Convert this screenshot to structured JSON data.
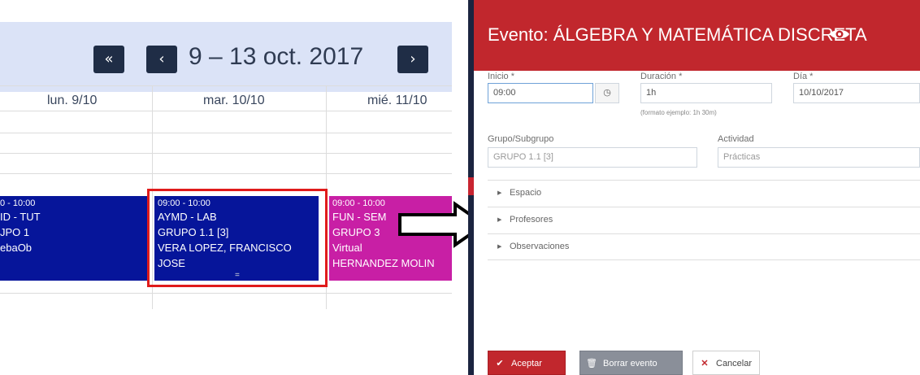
{
  "calendar": {
    "nav_first": "«",
    "nav_prev": "‹",
    "nav_next": "›",
    "title": "9 – 13 oct. 2017",
    "days": [
      "lun. 9/10",
      "mar. 10/10",
      "mié. 11/10"
    ],
    "events": [
      {
        "time": "0 - 10:00",
        "lines": [
          "ID - TUT",
          "JPO 1",
          "ebaOb"
        ],
        "color": "#06159a"
      },
      {
        "time": "09:00 - 10:00",
        "lines": [
          "AYMD - LAB",
          "GRUPO 1.1 [3]",
          "VERA LOPEZ, FRANCISCO",
          "JOSE"
        ],
        "handle": "=",
        "color": "#06159a"
      },
      {
        "time": "09:00 - 10:00",
        "lines": [
          "FUN - SEM",
          "GRUPO 3",
          "Virtual",
          "HERNANDEZ MOLIN"
        ],
        "color": "#c81fa5"
      }
    ],
    "highlight_color": "#e01b1b"
  },
  "modal": {
    "title": "Evento: ÁLGEBRA Y MATEMÁTICA DISCRETA",
    "header_color": "#c1272d",
    "eye_icon": "eye-icon",
    "inicio": {
      "label": "Inicio *",
      "value": "09:00",
      "clock_icon": "clock-icon",
      "clock_glyph": "◷"
    },
    "duracion": {
      "label": "Duración *",
      "value": "1h",
      "help": "(formato ejemplo: 1h 30m)"
    },
    "dia": {
      "label": "Día *",
      "value": "10/10/2017"
    },
    "grupo": {
      "label": "Grupo/Subgrupo",
      "value": "GRUPO 1.1 [3]"
    },
    "actividad": {
      "label": "Actividad",
      "value": "Prácticas"
    },
    "sections": [
      {
        "label": "Espacio"
      },
      {
        "label": "Profesores"
      },
      {
        "label": "Observaciones"
      }
    ],
    "buttons": {
      "accept": {
        "label": "Aceptar",
        "icon": "check-icon",
        "glyph": "✔"
      },
      "delete": {
        "label": "Borrar evento",
        "icon": "trash-icon",
        "glyph": "🗑"
      },
      "cancel": {
        "label": "Cancelar",
        "icon": "close-icon",
        "glyph": "✕"
      }
    }
  }
}
